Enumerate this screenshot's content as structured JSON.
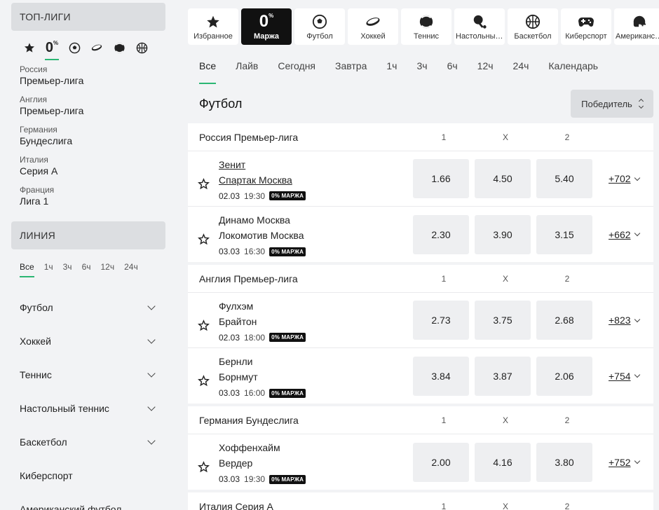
{
  "sidebar": {
    "top_title": "ТОП-ЛИГИ",
    "top_icons": [
      "star-icon",
      "zero-margin-icon",
      "football-icon",
      "hockey-icon",
      "tennis-icon",
      "basketball-icon"
    ],
    "zero_label": "0",
    "leagues": [
      {
        "country": "Россия",
        "league": "Премьер-лига"
      },
      {
        "country": "Англия",
        "league": "Премьер-лига"
      },
      {
        "country": "Германия",
        "league": "Бундеслига"
      },
      {
        "country": "Италия",
        "league": "Серия А"
      },
      {
        "country": "Франция",
        "league": "Лига 1"
      }
    ],
    "line_title": "ЛИНИЯ",
    "line_tabs": [
      "Все",
      "1ч",
      "3ч",
      "6ч",
      "12ч",
      "24ч"
    ],
    "sports": [
      {
        "label": "Футбол"
      },
      {
        "label": "Хоккей"
      },
      {
        "label": "Теннис"
      },
      {
        "label": "Настольный теннис"
      },
      {
        "label": "Баскетбол"
      },
      {
        "label": "Киберспорт"
      },
      {
        "label": "Американский футбол"
      }
    ]
  },
  "sport_tabs": [
    {
      "label": "Избранное",
      "icon": "star-icon"
    },
    {
      "label": "Маржа",
      "icon": "zero-margin-icon",
      "big": "0"
    },
    {
      "label": "Футбол",
      "icon": "football-icon"
    },
    {
      "label": "Хоккей",
      "icon": "hockey-icon"
    },
    {
      "label": "Теннис",
      "icon": "tennis-icon"
    },
    {
      "label": "Настольный теннис",
      "icon": "table-tennis-icon"
    },
    {
      "label": "Баскетбол",
      "icon": "basketball-icon"
    },
    {
      "label": "Киберспорт",
      "icon": "gamepad-icon"
    },
    {
      "label": "Американский футбол",
      "icon": "helmet-icon"
    }
  ],
  "period_tabs": [
    "Все",
    "Лайв",
    "Сегодня",
    "Завтра",
    "1ч",
    "3ч",
    "6ч",
    "12ч",
    "24ч",
    "Календарь"
  ],
  "section": {
    "title": "Футбол",
    "sort_label": "Победитель"
  },
  "odds_cols": [
    "1",
    "X",
    "2"
  ],
  "badge": "0% МАРЖА",
  "leagues": [
    {
      "name": "Россия Премьер-лига",
      "matches": [
        {
          "home": "Зенит",
          "away": "Спартак Москва",
          "date": "02.03",
          "time": "19:30",
          "o1": "1.66",
          "ox": "4.50",
          "o2": "5.40",
          "more": "+702"
        },
        {
          "home": "Динамо Москва",
          "away": "Локомотив Москва",
          "date": "03.03",
          "time": "16:30",
          "o1": "2.30",
          "ox": "3.90",
          "o2": "3.15",
          "more": "+662"
        }
      ]
    },
    {
      "name": "Англия Премьер-лига",
      "matches": [
        {
          "home": "Фулхэм",
          "away": "Брайтон",
          "date": "02.03",
          "time": "18:00",
          "o1": "2.73",
          "ox": "3.75",
          "o2": "2.68",
          "more": "+823"
        },
        {
          "home": "Бернли",
          "away": "Борнмут",
          "date": "03.03",
          "time": "16:00",
          "o1": "3.84",
          "ox": "3.87",
          "o2": "2.06",
          "more": "+754"
        }
      ]
    },
    {
      "name": "Германия Бундеслига",
      "matches": [
        {
          "home": "Хоффенхайм",
          "away": "Вердер",
          "date": "03.03",
          "time": "19:30",
          "o1": "2.00",
          "ox": "4.16",
          "o2": "3.80",
          "more": "+752"
        }
      ]
    },
    {
      "name": "Италия Серия А",
      "matches": []
    }
  ],
  "colors": {
    "accent": "#2bb673",
    "dark": "#111111",
    "panel": "#ffffff",
    "bg": "#f2f3f5"
  }
}
